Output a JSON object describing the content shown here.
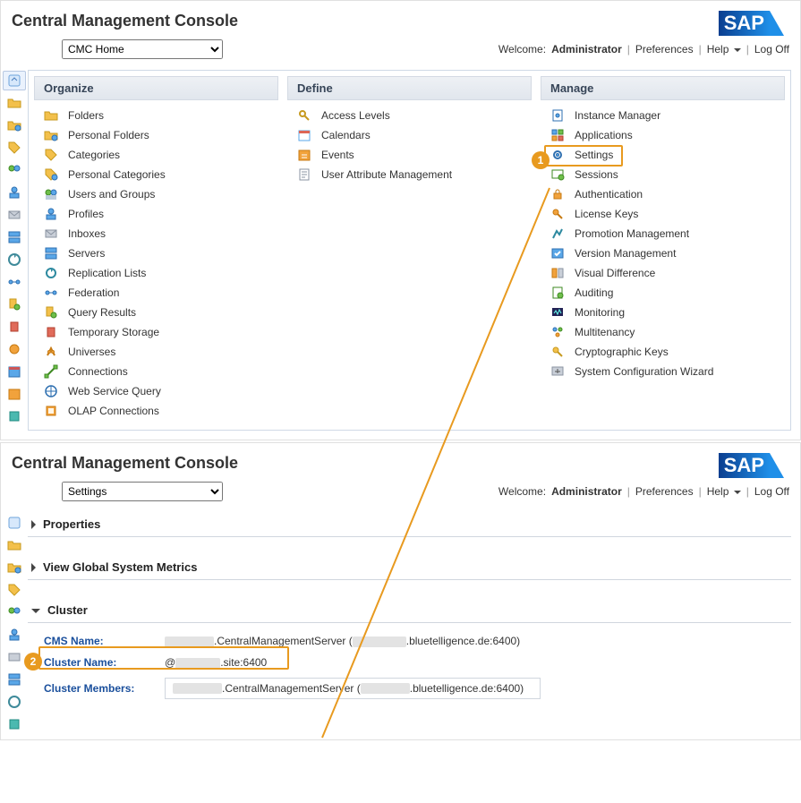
{
  "app_title": "Central Management Console",
  "logo_text": "SAP",
  "nav_select_top": "CMC Home",
  "nav_select_bottom": "Settings",
  "welcome_prefix": "Welcome:",
  "welcome_user": "Administrator",
  "links": {
    "preferences": "Preferences",
    "help": "Help",
    "logoff": "Log Off"
  },
  "columns": {
    "organize": {
      "title": "Organize",
      "items": [
        {
          "label": "Folders",
          "icon": "folder"
        },
        {
          "label": "Personal Folders",
          "icon": "folder-person"
        },
        {
          "label": "Categories",
          "icon": "tag"
        },
        {
          "label": "Personal Categories",
          "icon": "tag-person"
        },
        {
          "label": "Users and Groups",
          "icon": "users"
        },
        {
          "label": "Profiles",
          "icon": "profile"
        },
        {
          "label": "Inboxes",
          "icon": "inbox"
        },
        {
          "label": "Servers",
          "icon": "server"
        },
        {
          "label": "Replication Lists",
          "icon": "replication"
        },
        {
          "label": "Federation",
          "icon": "federation"
        },
        {
          "label": "Query Results",
          "icon": "query"
        },
        {
          "label": "Temporary Storage",
          "icon": "temp"
        },
        {
          "label": "Universes",
          "icon": "universe"
        },
        {
          "label": "Connections",
          "icon": "connection"
        },
        {
          "label": "Web Service Query",
          "icon": "webservice"
        },
        {
          "label": "OLAP Connections",
          "icon": "olap"
        }
      ]
    },
    "define": {
      "title": "Define",
      "items": [
        {
          "label": "Access Levels",
          "icon": "access"
        },
        {
          "label": "Calendars",
          "icon": "calendar"
        },
        {
          "label": "Events",
          "icon": "events"
        },
        {
          "label": "User Attribute Management",
          "icon": "userattr"
        }
      ]
    },
    "manage": {
      "title": "Manage",
      "items": [
        {
          "label": "Instance Manager",
          "icon": "instance"
        },
        {
          "label": "Applications",
          "icon": "apps"
        },
        {
          "label": "Settings",
          "icon": "settings"
        },
        {
          "label": "Sessions",
          "icon": "sessions"
        },
        {
          "label": "Authentication",
          "icon": "auth"
        },
        {
          "label": "License Keys",
          "icon": "license"
        },
        {
          "label": "Promotion Management",
          "icon": "promotion"
        },
        {
          "label": "Version Management",
          "icon": "version"
        },
        {
          "label": "Visual Difference",
          "icon": "visdiff"
        },
        {
          "label": "Auditing",
          "icon": "audit"
        },
        {
          "label": "Monitoring",
          "icon": "monitor"
        },
        {
          "label": "Multitenancy",
          "icon": "multi"
        },
        {
          "label": "Cryptographic Keys",
          "icon": "crypto"
        },
        {
          "label": "System Configuration Wizard",
          "icon": "syswiz"
        }
      ]
    }
  },
  "settings_page": {
    "sections": {
      "properties": "Properties",
      "metrics": "View Global System Metrics",
      "cluster": "Cluster"
    },
    "cluster": {
      "cms_label": "CMS Name:",
      "cms_value_mid": ".CentralManagementServer (",
      "cms_value_suffix": ".bluetelligence.de:6400)",
      "cluster_name_label": "Cluster Name:",
      "cluster_name_prefix": "@",
      "cluster_name_suffix": ".site:6400",
      "members_label": "Cluster Members:",
      "members_mid": ".CentralManagementServer (",
      "members_suffix": ".bluetelligence.de:6400)"
    }
  },
  "annotations": {
    "one": "1",
    "two": "2"
  }
}
